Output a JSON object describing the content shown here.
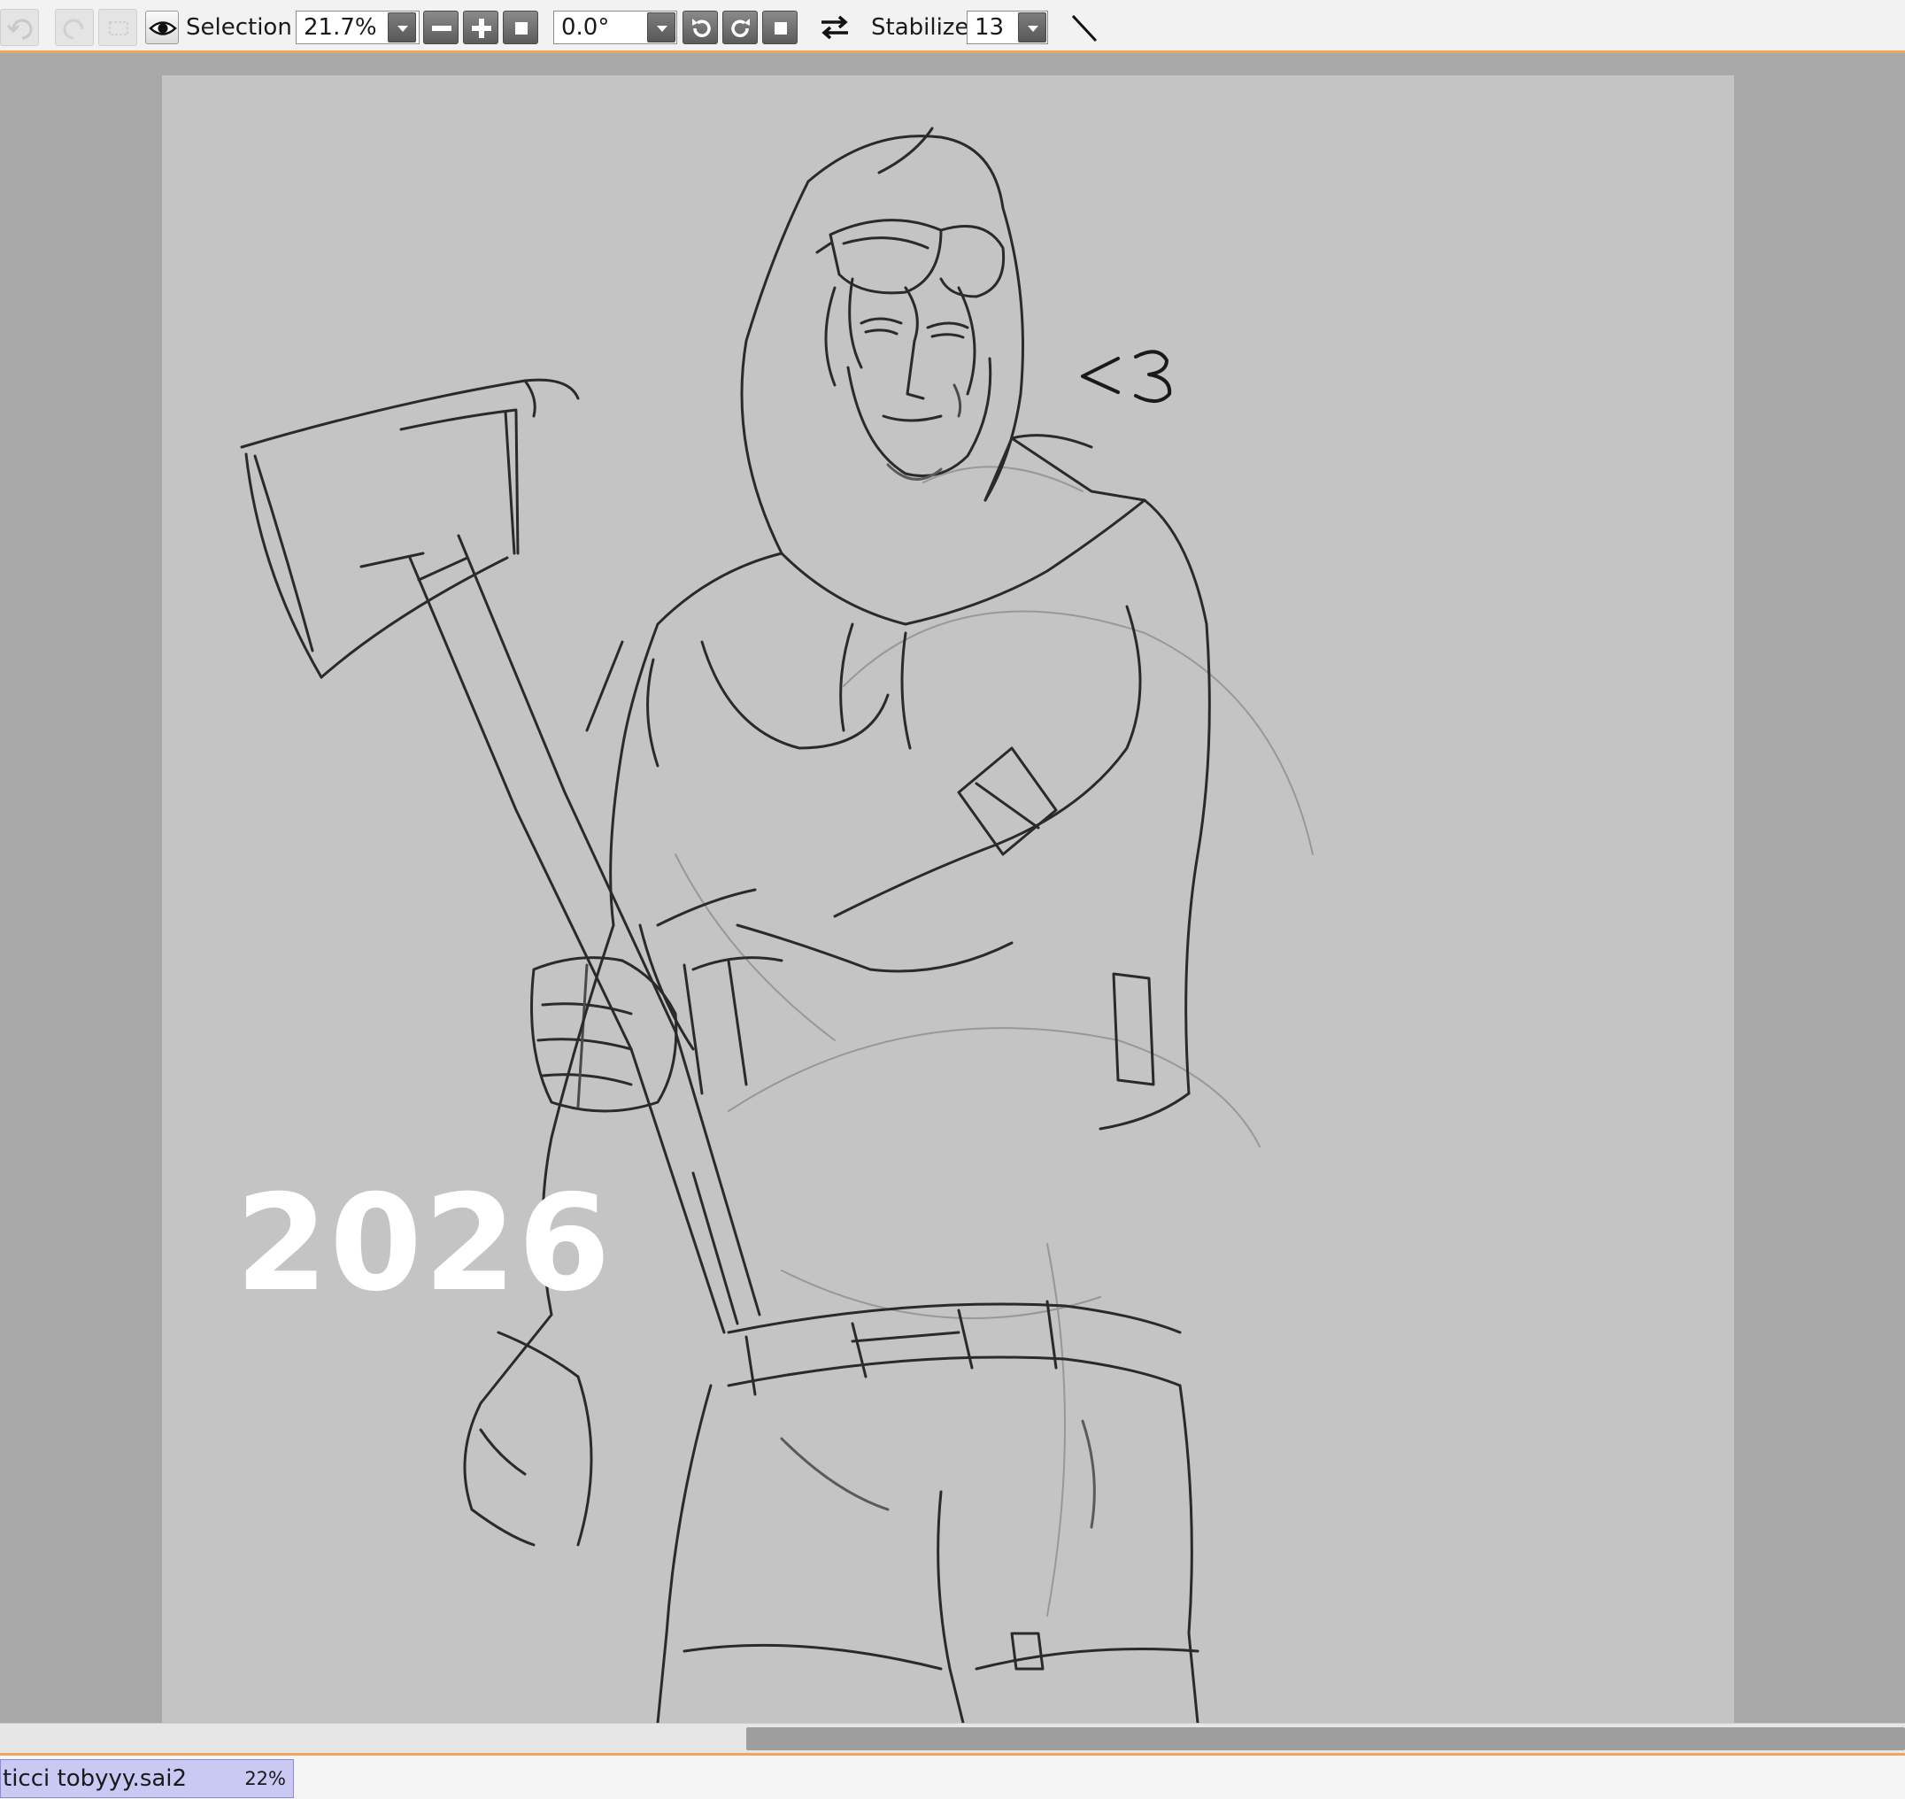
{
  "toolbar": {
    "selection_label": "Selection",
    "zoom_value": "21.7%",
    "rotation_value": "0.0°",
    "stabilizer_label": "Stabilizer",
    "stabilizer_value": "13",
    "icons": {
      "undo": "undo-icon",
      "redo": "redo-icon",
      "deselect": "deselect-icon",
      "view_selection": "eye-icon",
      "zoom_out": "minus-icon",
      "zoom_in": "plus-icon",
      "zoom_reset": "square-icon",
      "rotate_ccw": "rotate-ccw-icon",
      "rotate_cw": "rotate-cw-icon",
      "rotate_reset": "square-icon",
      "flip": "flip-horizontal-icon",
      "pen_line": "diagonal-line-icon"
    },
    "accent_color": "#f0a55a"
  },
  "canvas": {
    "year_text": "2026",
    "heart_text": "<3",
    "background_color": "#c4c4c4"
  },
  "document": {
    "file_name": "ticci tobyyy.sai2",
    "zoom": "22%",
    "tab_color": "#c9c9f3"
  }
}
